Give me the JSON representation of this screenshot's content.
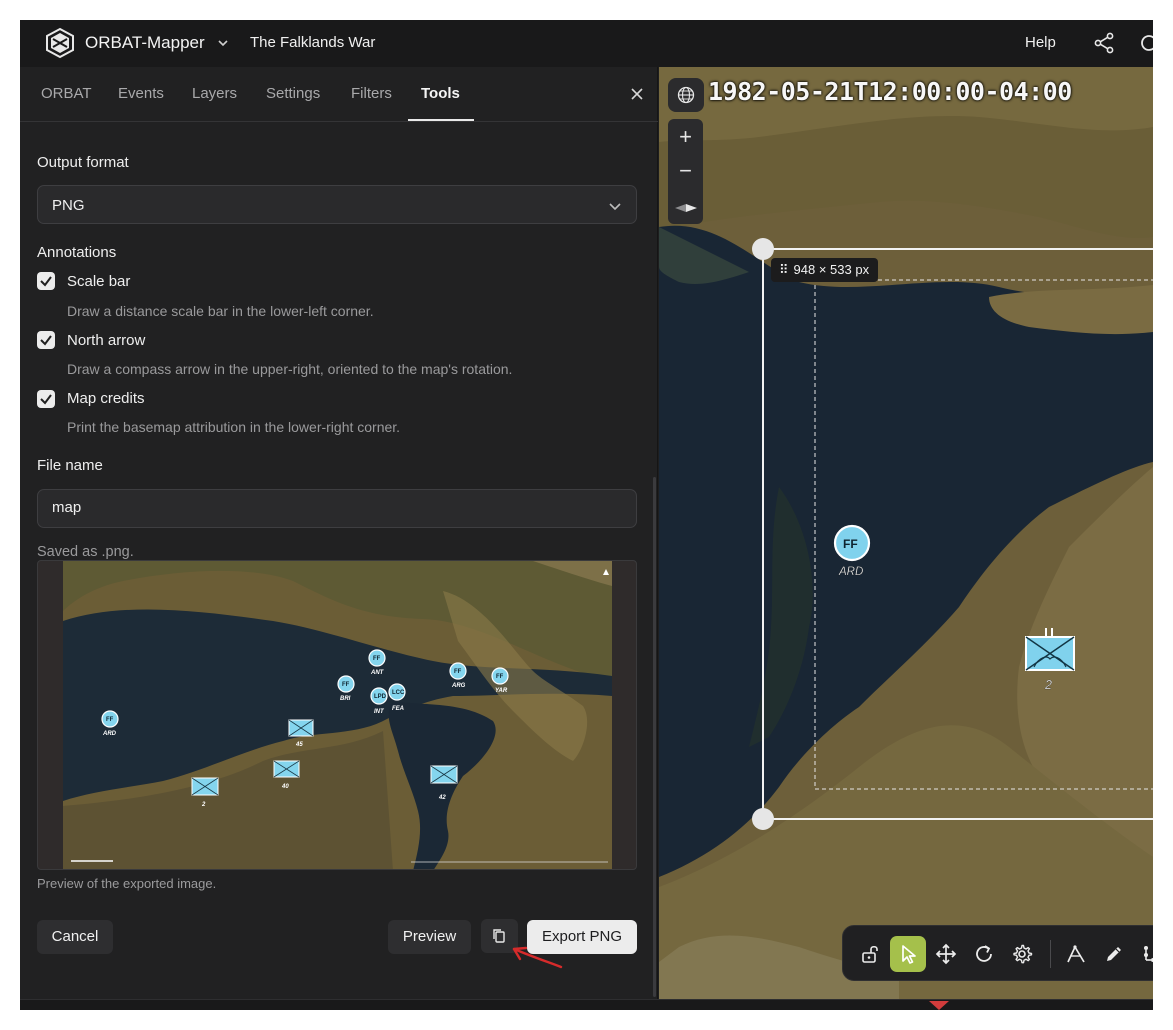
{
  "header": {
    "app_name": "ORBAT-Mapper",
    "scenario": "The Falklands War",
    "help": "Help",
    "icons": [
      "orbat-logo-icon",
      "chevron-down-icon",
      "share-icon",
      "search-icon"
    ]
  },
  "tabs": [
    {
      "label": "ORBAT",
      "active": false
    },
    {
      "label": "Events",
      "active": false
    },
    {
      "label": "Layers",
      "active": false
    },
    {
      "label": "Settings",
      "active": false
    },
    {
      "label": "Filters",
      "active": false
    },
    {
      "label": "Tools",
      "active": true
    }
  ],
  "export": {
    "output_format_label": "Output format",
    "output_format_value": "PNG",
    "annotations_label": "Annotations",
    "options": [
      {
        "label": "Scale bar",
        "desc": "Draw a distance scale bar in the lower-left corner.",
        "checked": true
      },
      {
        "label": "North arrow",
        "desc": "Draw a compass arrow in the upper-right, oriented to the map's rotation.",
        "checked": true
      },
      {
        "label": "Map credits",
        "desc": "Print the basemap attribution in the lower-right corner.",
        "checked": true
      }
    ],
    "file_name_label": "File name",
    "file_name_value": "map",
    "saved_as": "Saved as .png.",
    "preview_caption": "Preview of the exported image.",
    "preview_units": [
      "FF",
      "ARD",
      "FF",
      "ANT",
      "FF",
      "BRI",
      "LPD",
      "INT",
      "LCC",
      "FEA",
      "FF",
      "ARG",
      "FF",
      "YAR",
      "2",
      "45",
      "40",
      "42"
    ],
    "buttons": {
      "cancel": "Cancel",
      "preview": "Preview",
      "export": "Export PNG"
    }
  },
  "map": {
    "time": "1982-05-21T12:00:00-04:00",
    "zoom_in": "+",
    "zoom_out": "−",
    "export_size": "948 × 533 px",
    "units": [
      {
        "symbol": "FF",
        "label": "ARD"
      },
      {
        "symbol": "infantry",
        "label": "2"
      }
    ],
    "toolbar_icons": [
      "unlock-icon",
      "select-pointer-icon",
      "move-icon",
      "rotate-icon",
      "gear-icon",
      "measure-icon",
      "pencil-icon",
      "more-icon"
    ],
    "accent_color": "#a5c04b"
  }
}
